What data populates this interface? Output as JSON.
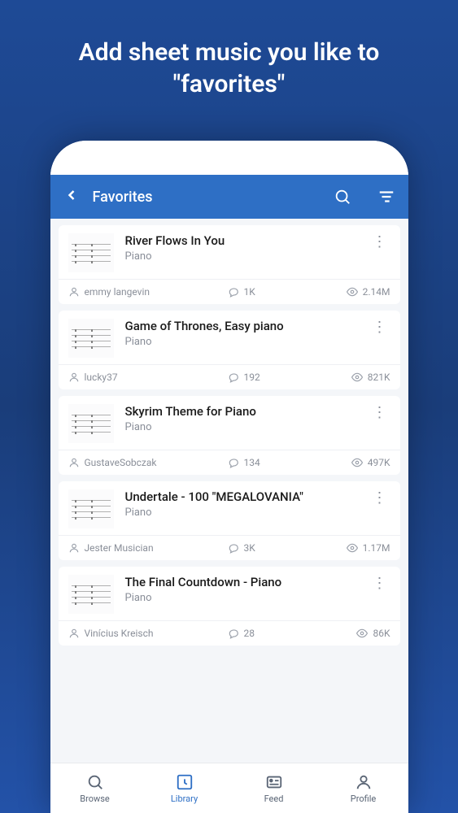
{
  "promo": {
    "line1": "Add sheet music you like to",
    "line2": "\"favorites\""
  },
  "header": {
    "title": "Favorites"
  },
  "items": [
    {
      "title": "River Flows In You",
      "instrument": "Piano",
      "user": "emmy langevin",
      "comments": "1K",
      "views": "2.14M"
    },
    {
      "title": "Game of Thrones, Easy piano",
      "instrument": "Piano",
      "user": "lucky37",
      "comments": "192",
      "views": "821K"
    },
    {
      "title": "Skyrim Theme for Piano",
      "instrument": "Piano",
      "user": "GustaveSobczak",
      "comments": "134",
      "views": "497K"
    },
    {
      "title": "Undertale - 100 \"MEGALOVANIA\"",
      "instrument": "Piano",
      "user": "Jester Musician",
      "comments": "3K",
      "views": "1.17M"
    },
    {
      "title": "The Final Countdown - Piano",
      "instrument": "Piano",
      "user": "Vinícius Kreisch",
      "comments": "28",
      "views": "86K"
    }
  ],
  "nav": {
    "browse": "Browse",
    "library": "Library",
    "feed": "Feed",
    "profile": "Profile"
  }
}
